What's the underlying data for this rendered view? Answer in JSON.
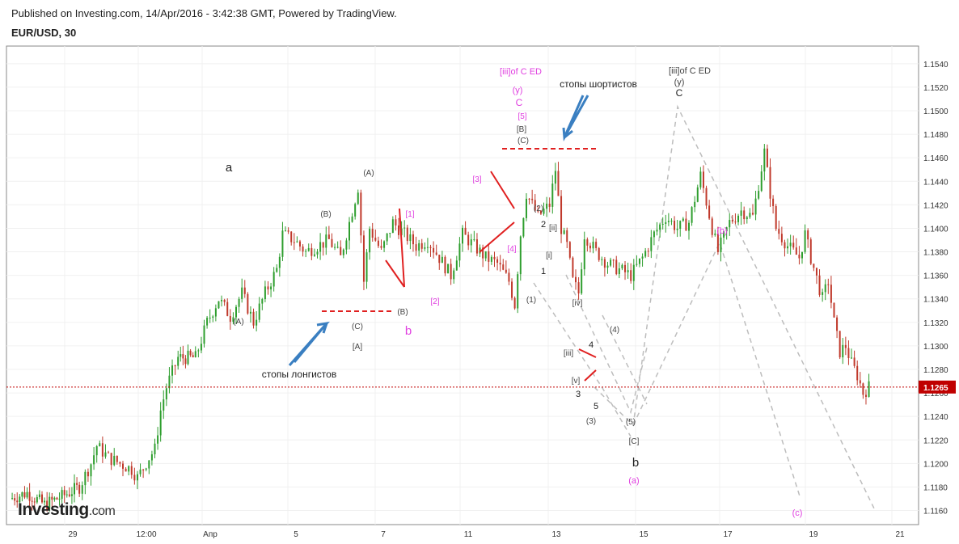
{
  "header": {
    "published": "Published on Investing.com, 14/Apr/2016 - 3:42:38 GMT, Powered by TradingView.",
    "symbol": "EUR/USD, 30"
  },
  "logo": {
    "main": "Investing",
    "suffix": ".com"
  },
  "colors": {
    "up": "#2e9e2e",
    "down": "#c0392b",
    "magenta": "#e040e0",
    "red": "#e02020",
    "blue": "#3a7fc1",
    "projection": "#bdbdbd",
    "price_line": "#c00000"
  },
  "chart_data": {
    "type": "candlestick",
    "timeframe": "30",
    "y_ticks": [
      "1.1540",
      "1.1520",
      "1.1500",
      "1.1480",
      "1.1460",
      "1.1440",
      "1.1420",
      "1.1400",
      "1.1380",
      "1.1360",
      "1.1340",
      "1.1320",
      "1.1300",
      "1.1280",
      "1.1260",
      "1.1240",
      "1.1220",
      "1.1200",
      "1.1180",
      "1.1160"
    ],
    "ylim": [
      1.1148,
      1.1555
    ],
    "x_ticks": [
      "29",
      "12:00",
      "Апр",
      "5",
      "7",
      "11",
      "13",
      "15",
      "17",
      "19",
      "21"
    ],
    "current_price": "1.1265",
    "price_path": [
      [
        0,
        1.117
      ],
      [
        3,
        1.1175
      ],
      [
        6,
        1.1165
      ],
      [
        9,
        1.1172
      ],
      [
        12,
        1.118
      ],
      [
        14,
        1.12
      ],
      [
        15,
        1.1215
      ],
      [
        17,
        1.1205
      ],
      [
        19,
        1.12
      ],
      [
        21,
        1.1195
      ],
      [
        22,
        1.1188
      ],
      [
        24,
        1.1205
      ],
      [
        25,
        1.1212
      ],
      [
        26,
        1.1245
      ],
      [
        27,
        1.1265
      ],
      [
        29,
        1.129
      ],
      [
        32,
        1.129
      ],
      [
        34,
        1.132
      ],
      [
        36,
        1.134
      ],
      [
        38,
        1.1325
      ],
      [
        40,
        1.1345
      ],
      [
        42,
        1.132
      ],
      [
        44,
        1.1345
      ],
      [
        46,
        1.1365
      ],
      [
        47,
        1.1395
      ],
      [
        49,
        1.139
      ],
      [
        51,
        1.138
      ],
      [
        53,
        1.1385
      ],
      [
        55,
        1.139
      ],
      [
        57,
        1.1375
      ],
      [
        59,
        1.1415
      ],
      [
        60,
        1.1435
      ],
      [
        61,
        1.1355
      ],
      [
        62,
        1.14
      ],
      [
        64,
        1.138
      ],
      [
        66,
        1.1405
      ],
      [
        68,
        1.1395
      ],
      [
        70,
        1.1385
      ],
      [
        72,
        1.139
      ],
      [
        74,
        1.1375
      ],
      [
        76,
        1.136
      ],
      [
        78,
        1.1395
      ],
      [
        80,
        1.1385
      ],
      [
        82,
        1.1375
      ],
      [
        84,
        1.137
      ],
      [
        86,
        1.1355
      ],
      [
        87,
        1.1335
      ],
      [
        88,
        1.1395
      ],
      [
        89,
        1.143
      ],
      [
        91,
        1.141
      ],
      [
        93,
        1.142
      ],
      [
        94,
        1.145
      ],
      [
        95,
        1.14
      ],
      [
        96,
        1.1385
      ],
      [
        97,
        1.1355
      ],
      [
        98,
        1.1345
      ],
      [
        99,
        1.1395
      ],
      [
        101,
        1.138
      ],
      [
        103,
        1.137
      ],
      [
        105,
        1.1365
      ],
      [
        107,
        1.136
      ],
      [
        109,
        1.1375
      ],
      [
        111,
        1.1395
      ],
      [
        113,
        1.141
      ],
      [
        115,
        1.14
      ],
      [
        117,
        1.1405
      ],
      [
        119,
        1.1445
      ],
      [
        121,
        1.14
      ],
      [
        122,
        1.138
      ],
      [
        124,
        1.1405
      ],
      [
        126,
        1.1415
      ],
      [
        128,
        1.141
      ],
      [
        130,
        1.1465
      ],
      [
        131,
        1.143
      ],
      [
        132,
        1.14
      ],
      [
        134,
        1.1385
      ],
      [
        136,
        1.1375
      ],
      [
        137,
        1.1395
      ],
      [
        138,
        1.1375
      ],
      [
        140,
        1.134
      ],
      [
        141,
        1.1355
      ],
      [
        142,
        1.132
      ],
      [
        143,
        1.1295
      ],
      [
        144,
        1.13
      ],
      [
        145,
        1.1285
      ],
      [
        146,
        1.1275
      ],
      [
        147,
        1.126
      ],
      [
        148,
        1.1265
      ]
    ],
    "x_range": [
      0,
      156
    ],
    "wave_labels": [
      {
        "text": "a",
        "x": 1,
        "color": "#222",
        "y": 1.145,
        "size": 15
      },
      {
        "text": "(A)",
        "x": 2,
        "color": "#444",
        "y": 1.1316,
        "size": 10
      },
      {
        "text": "(B)",
        "x": 3,
        "color": "#444",
        "y": 1.141,
        "size": 10
      },
      {
        "text": "(C)",
        "x": 4,
        "color": "#444",
        "y": 1.1312,
        "size": 10
      },
      {
        "text": "[A]",
        "x": 5,
        "color": "#444",
        "y": 1.1296,
        "size": 10
      },
      {
        "text": "(A)",
        "x": 6,
        "color": "#444",
        "y": 1.1448,
        "size": 10
      },
      {
        "text": "[1]",
        "x": 7,
        "color": "#e040e0",
        "y": 1.141,
        "size": 10
      },
      {
        "text": "(B)",
        "x": 8,
        "color": "#444",
        "y": 1.1332,
        "size": 10
      },
      {
        "text": "b",
        "x": 9,
        "color": "#e040e0",
        "y": 1.1312,
        "size": 15
      },
      {
        "text": "[2]",
        "x": 10,
        "color": "#e040e0",
        "y": 1.1342,
        "size": 10
      },
      {
        "text": "[3]",
        "x": 11,
        "color": "#e040e0",
        "y": 1.1442,
        "size": 10
      },
      {
        "text": "[4]",
        "x": 12,
        "color": "#e040e0",
        "y": 1.1378,
        "size": 10
      },
      {
        "text": "[iii]of C ED",
        "x": 13,
        "color": "#e040e0",
        "y": 1.1532,
        "size": 11
      },
      {
        "text": "(y)",
        "x": 14,
        "color": "#e040e0",
        "y": 1.1516,
        "size": 11
      },
      {
        "text": "C",
        "x": 15,
        "color": "#e040e0",
        "y": 1.15,
        "size": 12
      },
      {
        "text": "[5]",
        "x": 16,
        "color": "#e040e0",
        "y": 1.1484,
        "size": 10
      },
      {
        "text": "[B]",
        "x": 17,
        "color": "#444",
        "y": 1.147,
        "size": 10
      },
      {
        "text": "(C)",
        "x": 18,
        "color": "#444",
        "y": 1.1458,
        "size": 10
      },
      {
        "text": "стопы шортистов",
        "x": 19,
        "color": "#222",
        "y": 1.152,
        "size": 12
      },
      {
        "text": "[iii]of C ED",
        "x": 20,
        "color": "#444",
        "y": 1.1534,
        "size": 11
      },
      {
        "text": "(y)",
        "x": 21,
        "color": "#444",
        "y": 1.152,
        "size": 11
      },
      {
        "text": "C",
        "x": 22,
        "color": "#222",
        "y": 1.1505,
        "size": 12
      },
      {
        "text": "(2)",
        "x": 23,
        "color": "#444",
        "y": 1.1405,
        "size": 10
      },
      {
        "text": "2",
        "x": 24,
        "color": "#222",
        "y": 1.14,
        "size": 11
      },
      {
        "text": "[ii]",
        "x": 25,
        "color": "#444",
        "y": 1.1394,
        "size": 10
      },
      {
        "text": "[i]",
        "x": 26,
        "color": "#444",
        "y": 1.1372,
        "size": 10
      },
      {
        "text": "1",
        "x": 27,
        "color": "#222",
        "y": 1.136,
        "size": 11
      },
      {
        "text": "(1)",
        "x": 28,
        "color": "#444",
        "y": 1.133,
        "size": 10
      },
      {
        "text": "[iv]",
        "x": 29,
        "color": "#444",
        "y": 1.1332,
        "size": 10
      },
      {
        "text": "(4)",
        "x": 30,
        "color": "#444",
        "y": 1.131,
        "size": 10
      },
      {
        "text": "4",
        "x": 31,
        "color": "#222",
        "y": 1.1288,
        "size": 11
      },
      {
        "text": "[iii]",
        "x": 32,
        "color": "#444",
        "y": 1.1282,
        "size": 10
      },
      {
        "text": "[v]",
        "x": 33,
        "color": "#444",
        "y": 1.126,
        "size": 10
      },
      {
        "text": "3",
        "x": 34,
        "color": "#222",
        "y": 1.1252,
        "size": 11
      },
      {
        "text": "5",
        "x": 35,
        "color": "#222",
        "y": 1.124,
        "size": 11
      },
      {
        "text": "(3)",
        "x": 36,
        "color": "#444",
        "y": 1.1228,
        "size": 10
      },
      {
        "text": "(5)",
        "x": 37,
        "color": "#444",
        "y": 1.1228,
        "size": 10
      },
      {
        "text": "[C]",
        "x": 38,
        "color": "#444",
        "y": 1.1208,
        "size": 10
      },
      {
        "text": "b",
        "x": 39,
        "color": "#222",
        "y": 1.1192,
        "size": 15
      },
      {
        "text": "(a)",
        "x": 40,
        "color": "#e040e0",
        "y": 1.1168,
        "size": 11
      },
      {
        "text": "(b)",
        "x": 41,
        "color": "#e040e0",
        "y": 1.1398,
        "size": 11
      },
      {
        "text": "(c)",
        "x": 42,
        "color": "#e040e0",
        "y": 1.115,
        "size": 11
      },
      {
        "text": "стопы лонгистов",
        "x": 43,
        "color": "#222",
        "y": 1.1262,
        "size": 12
      }
    ]
  }
}
